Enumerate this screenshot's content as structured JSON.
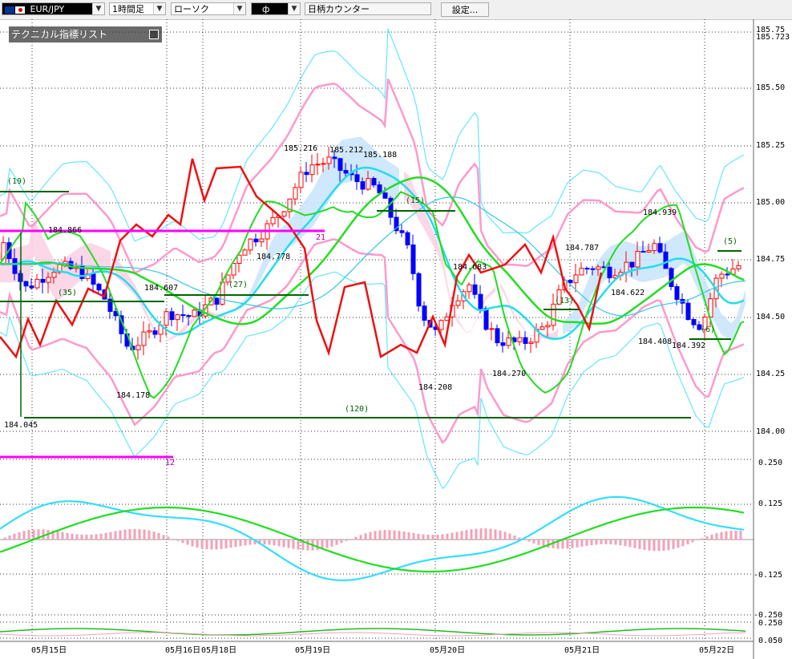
{
  "toolbar": {
    "symbol": "EUR/JPY",
    "timeframe": "1時間足",
    "chart_style": "ローソク",
    "symbol_input": "ф",
    "counter_label": "日柄カウンター",
    "settings_label": "設定..."
  },
  "indicator_panel": {
    "title": "テクニカル指標リスト"
  },
  "colors": {
    "up_candle": "#ff0000",
    "down_candle": "#0000ff",
    "bollinger_outer": "#66e6ff",
    "bollinger_inner": "#ff99cc",
    "ma_green": "#22dd22",
    "ma_cyan": "#22ddee",
    "red_line": "#ee1111",
    "level_line": "#006400",
    "magenta_line": "#ff00ff",
    "cloud_blue": "#c8e4fa",
    "cloud_pink": "#fcd0e4"
  },
  "chart_data": {
    "type": "candlestick",
    "symbol": "EUR/JPY",
    "timeframe": "1h",
    "y_axis": {
      "ticks": [
        "185.75",
        "185.50",
        "185.25",
        "185.00",
        "184.75",
        "184.50",
        "184.25",
        "184.00"
      ],
      "current_price": "185.723",
      "ylim": [
        184.0,
        185.75
      ]
    },
    "x_axis": {
      "labels": [
        "05月15日",
        "05月16日",
        "05月18日",
        "05月19日",
        "05月20日",
        "05月21日",
        "05月22日"
      ]
    },
    "price_labels": [
      "184.866",
      "184.607",
      "184.178",
      "184.045",
      "184.778",
      "185.216",
      "185.212",
      "185.188",
      "184.208",
      "184.683",
      "184.270",
      "184.787",
      "184.939",
      "184.622",
      "184.408",
      "184.392"
    ],
    "level_labels": [
      "(19)",
      "(35)",
      "(27)",
      "(15)",
      "(120)",
      "(5)",
      "(13)",
      "(6)",
      "21",
      "12"
    ],
    "oscillator": {
      "ticks": [
        "0.250",
        "0.125",
        "-0.125",
        "-0.250"
      ]
    },
    "lower_panel": {
      "ticks": [
        "0.250",
        "0.050"
      ]
    }
  }
}
